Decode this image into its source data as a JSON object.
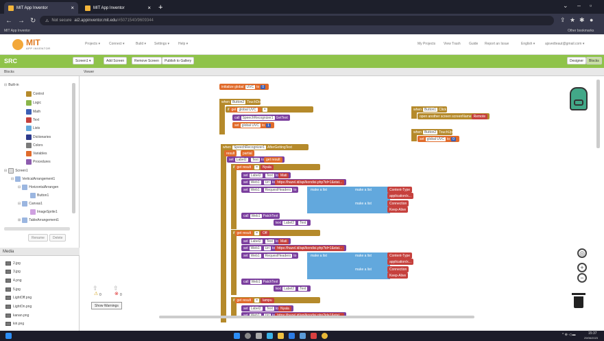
{
  "browser": {
    "tabs": [
      {
        "label": "MIT App Inventor",
        "close": "×"
      },
      {
        "label": "MIT App Inventor",
        "close": "×"
      }
    ],
    "new_tab": "+",
    "url_warning": "Not secure",
    "url_host": "ai2.appinventor.mit.edu",
    "url_path": "/#5071540/9609344",
    "bookmark_left": "MIT App Inventor",
    "bookmark_right": "Other bookmarks"
  },
  "header": {
    "logo_title": "MIT",
    "logo_subtitle": "APP INVENTOR",
    "menu": [
      "Projects ▾",
      "Connect ▾",
      "Build ▾",
      "Settings ▾",
      "Help ▾"
    ],
    "right_menu": [
      "My Projects",
      "View Trash",
      "Guide",
      "Report an Issue",
      "English ▾",
      "ajsvedteaut@gmail.com ▾"
    ]
  },
  "project": {
    "name": "SRC",
    "buttons": [
      "Screen1 ▾",
      "Add Screen",
      "Remove Screen",
      "Publish to Gallery"
    ],
    "mode_buttons": [
      "Designer",
      "Blocks"
    ]
  },
  "panels": {
    "blocks": "Blocks",
    "viewer": "Viewer",
    "media": "Media"
  },
  "tree": {
    "builtin": "Built-in",
    "builtin_items": [
      {
        "label": "Control",
        "color": "#b58a2b"
      },
      {
        "label": "Logic",
        "color": "#8ab54a"
      },
      {
        "label": "Math",
        "color": "#3c5fb5"
      },
      {
        "label": "Text",
        "color": "#c6413d"
      },
      {
        "label": "Lists",
        "color": "#62a8dd"
      },
      {
        "label": "Dictionaries",
        "color": "#2d3a8c"
      },
      {
        "label": "Colors",
        "color": "#7a7a7a"
      },
      {
        "label": "Variables",
        "color": "#e06b2b"
      },
      {
        "label": "Procedures",
        "color": "#8d5cae"
      }
    ],
    "components": [
      "Screen1",
      "VerticalArrangement1",
      "HorizontalArrangen",
      "Button1",
      "Canvas1",
      "ImageSprite1",
      "TableArrangement1"
    ],
    "rename": "Rename",
    "delete": "Delete"
  },
  "media": [
    "2.jpg",
    "3.jpg",
    "4.png",
    "5.jpg",
    "LightOff.png",
    "LightOn.png",
    "kanan.png",
    "kiri.png"
  ],
  "workspace": {
    "init_global": "initialize global",
    "init_var": "UVC",
    "init_to": "to",
    "when1": "when",
    "when1_comp": "Button2",
    "when1_event": "TouchDown",
    "do": "do",
    "if": "if",
    "get": "get",
    "global_uvc": "global UVC",
    "eq": "=",
    "then": "then",
    "call": "call",
    "speech": "SpeechRecognizer1",
    "gettext": "GetText",
    "set": "set",
    "when2_comp": "Button1",
    "when2_event": "Click",
    "open_screen": "open another screen  screenName",
    "remote": "Remote",
    "when3_comp": "Button2",
    "when3_event": "TouchUp",
    "after_text": "AfterGettingText",
    "result": "result",
    "partial": "partial",
    "label": "Label2",
    "text": "Text",
    "get_result": "get result",
    "lamp_on": "Nyala",
    "lamp_off": "Mati",
    "web": "Web1",
    "url": "Url",
    "url_value": "https://hazel.id/api/kondisi.php?id=1&stat...",
    "req_headers": "RequestHeaders",
    "make_list": "make a list",
    "content_type": "Content-Type",
    "app_form": "application/x...",
    "connection": "Connection",
    "keep_alive": "Keep-Alive",
    "patch": "PatchText",
    "text_label": "text",
    "off": "Off",
    "lamp": "lampu"
  },
  "warnings": {
    "warn_count": "0",
    "err_count": "0",
    "show": "Show Warnings"
  },
  "tray": {
    "time": "15:37",
    "date": "29/06/2023"
  }
}
